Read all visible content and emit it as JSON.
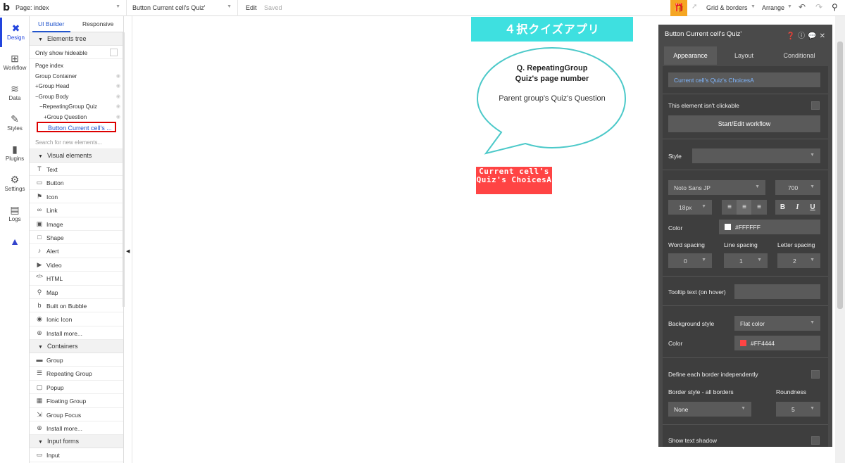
{
  "topbar": {
    "logo": "b",
    "page_select": "Page: index",
    "element_select": "Button Current cell's Quiz'",
    "edit": "Edit",
    "saved": "Saved",
    "grid": "Grid & borders",
    "arrange": "Arrange"
  },
  "sidebar": {
    "items": [
      {
        "label": "Design",
        "icon": "design-icon",
        "glyph": "✖"
      },
      {
        "label": "Workflow",
        "icon": "workflow-icon",
        "glyph": "⊞"
      },
      {
        "label": "Data",
        "icon": "data-icon",
        "glyph": "≋"
      },
      {
        "label": "Styles",
        "icon": "styles-icon",
        "glyph": "✎"
      },
      {
        "label": "Plugins",
        "icon": "plugins-icon",
        "glyph": "▮"
      },
      {
        "label": "Settings",
        "icon": "settings-icon",
        "glyph": "⚙"
      },
      {
        "label": "Logs",
        "icon": "logs-icon",
        "glyph": "▤"
      },
      {
        "label": "",
        "icon": "bubble-logo-icon",
        "glyph": "▲"
      }
    ]
  },
  "panel": {
    "tab_builder": "UI Builder",
    "tab_responsive": "Responsive",
    "tree_header": "Elements tree",
    "only_hideable": "Only show hideable",
    "tree": [
      "Page index",
      "Group Container",
      "+Group Head",
      "−Group Body",
      "−RepeatingGroup Quiz",
      "+Group Question",
      "Button Current cell's ..."
    ],
    "search_placeholder": "Search for new elements...",
    "visual_header": "Visual elements",
    "visual": [
      {
        "label": "Text",
        "icon": "T"
      },
      {
        "label": "Button",
        "icon": "▭"
      },
      {
        "label": "Icon",
        "icon": "⚑"
      },
      {
        "label": "Link",
        "icon": "∞"
      },
      {
        "label": "Image",
        "icon": "▣"
      },
      {
        "label": "Shape",
        "icon": "□"
      },
      {
        "label": "Alert",
        "icon": "♪"
      },
      {
        "label": "Video",
        "icon": "▶"
      },
      {
        "label": "HTML",
        "icon": "</>"
      },
      {
        "label": "Map",
        "icon": "⚲"
      },
      {
        "label": "Built on Bubble",
        "icon": "b"
      },
      {
        "label": "Ionic Icon",
        "icon": "◉"
      },
      {
        "label": "Install more...",
        "icon": "⊕"
      }
    ],
    "containers_header": "Containers",
    "containers": [
      {
        "label": "Group",
        "icon": "▬"
      },
      {
        "label": "Repeating Group",
        "icon": "☰"
      },
      {
        "label": "Popup",
        "icon": "▢"
      },
      {
        "label": "Floating Group",
        "icon": "▦"
      },
      {
        "label": "Group Focus",
        "icon": "⇲"
      },
      {
        "label": "Install more...",
        "icon": "⊕"
      }
    ],
    "inputs_header": "Input forms",
    "inputs": [
      {
        "label": "Input",
        "icon": "▭"
      }
    ]
  },
  "canvas": {
    "title": "４択クイズアプリ",
    "question_line1": "Q. RepeatingGroup",
    "question_line2": "Quiz's page number",
    "parent_text": "Parent group's Quiz's Question",
    "answer_button": "Current cell's Quiz's ChoicesA"
  },
  "props": {
    "title": "Button Current cell's Quiz'",
    "tabs": [
      "Appearance",
      "Layout",
      "Conditional"
    ],
    "text_value": "Current cell's Quiz's ChoicesA",
    "not_clickable": "This element isn't clickable",
    "workflow_btn": "Start/Edit workflow",
    "style_label": "Style",
    "font": "Noto Sans JP",
    "weight": "700",
    "size": "18px",
    "color_label": "Color",
    "text_color": "#FFFFFF",
    "word_spacing_label": "Word spacing",
    "line_spacing_label": "Line spacing",
    "letter_spacing_label": "Letter spacing",
    "word_spacing": "0",
    "line_spacing": "1",
    "letter_spacing": "2",
    "tooltip_label": "Tooltip text (on hover)",
    "bg_style_label": "Background style",
    "bg_style": "Flat color",
    "bg_color_label": "Color",
    "bg_color": "#FF4444",
    "border_independent": "Define each border independently",
    "border_style_label": "Border style - all borders",
    "roundness_label": "Roundness",
    "border_style": "None",
    "roundness": "5",
    "text_shadow": "Show text shadow"
  },
  "colors": {
    "accent": "#2255cc",
    "title_bg": "#3ee0e0",
    "button_bg": "#FF4444",
    "bubble_stroke": "#4cc9c9",
    "highlight": "#dd0000",
    "props_bg": "#4a4a4a"
  }
}
